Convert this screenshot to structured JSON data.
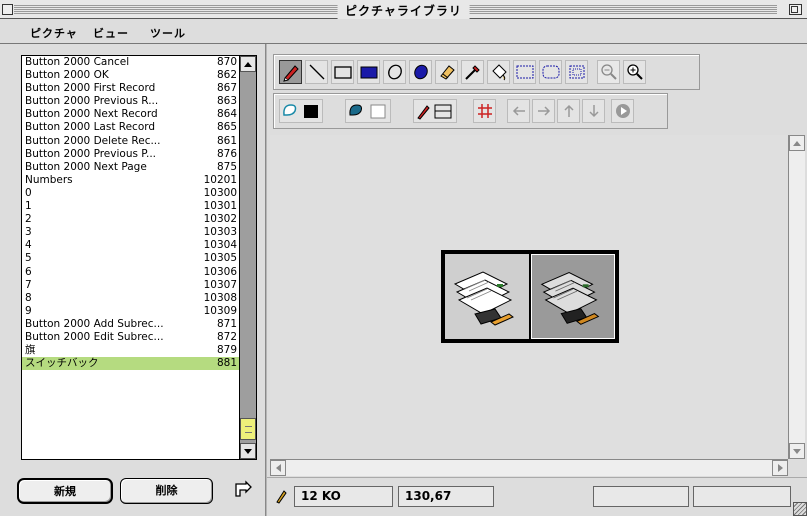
{
  "window": {
    "title": "ピクチャライブラリ"
  },
  "menu": [
    "ピクチャ",
    "ビュー",
    "ツール"
  ],
  "list": [
    {
      "name": "Button 2000 Cancel",
      "id": "870"
    },
    {
      "name": "Button 2000 OK",
      "id": "862"
    },
    {
      "name": "Button 2000 First Record",
      "id": "867"
    },
    {
      "name": "Button 2000 Previous R...",
      "id": "863"
    },
    {
      "name": "Button 2000 Next Record",
      "id": "864"
    },
    {
      "name": "Button 2000 Last Record",
      "id": "865"
    },
    {
      "name": "Button 2000 Delete Rec...",
      "id": "861"
    },
    {
      "name": "Button 2000 Previous P...",
      "id": "876"
    },
    {
      "name": "Button 2000 Next Page",
      "id": "875"
    },
    {
      "name": "Numbers",
      "id": "10201"
    },
    {
      "name": "0",
      "id": "10300"
    },
    {
      "name": "1",
      "id": "10301"
    },
    {
      "name": "2",
      "id": "10302"
    },
    {
      "name": "3",
      "id": "10303"
    },
    {
      "name": "4",
      "id": "10304"
    },
    {
      "name": "5",
      "id": "10305"
    },
    {
      "name": "6",
      "id": "10306"
    },
    {
      "name": "7",
      "id": "10307"
    },
    {
      "name": "8",
      "id": "10308"
    },
    {
      "name": "9",
      "id": "10309"
    },
    {
      "name": "Button 2000 Add Subrec...",
      "id": "871"
    },
    {
      "name": "Button 2000 Edit Subrec...",
      "id": "872"
    },
    {
      "name": "旗",
      "id": "879"
    },
    {
      "name": "スイッチバック",
      "id": "881",
      "selected": true
    }
  ],
  "buttons": {
    "new": "新規",
    "delete": "削除"
  },
  "status": {
    "size": "12 KO",
    "coords": "130,67"
  },
  "colors": {
    "selected_row": "#b5db80",
    "scroll_thumb": "#eef07a",
    "zoom_icon": "#1a1aa8"
  }
}
